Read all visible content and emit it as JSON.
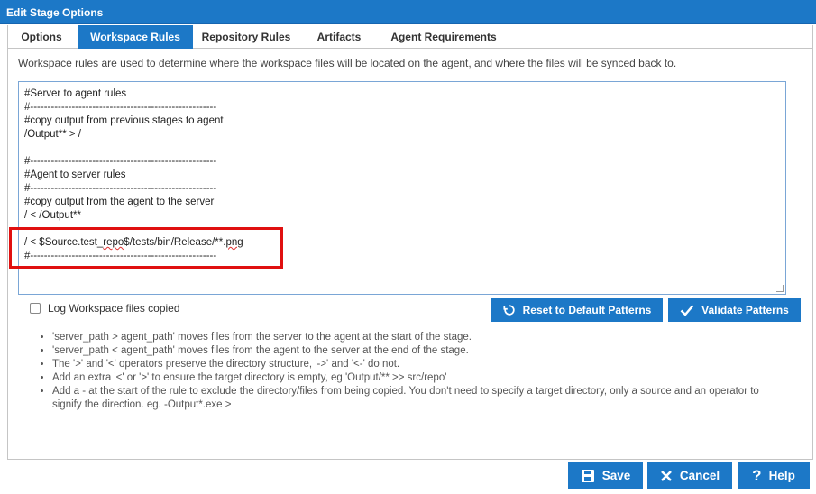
{
  "window": {
    "title": "Edit Stage Options"
  },
  "tabs": [
    {
      "label": "Options"
    },
    {
      "label": "Workspace Rules"
    },
    {
      "label": "Repository Rules"
    },
    {
      "label": "Artifacts"
    },
    {
      "label": "Agent Requirements"
    }
  ],
  "description": "Workspace rules are used to determine where the workspace files will be located on the agent, and where the files will be synced back to.",
  "editor": {
    "lines": [
      "#Server to agent rules",
      "#------------------------------------------------------",
      "#copy output from previous stages to agent",
      "/Output** > /",
      "",
      "#------------------------------------------------------",
      "#Agent to server rules",
      "#------------------------------------------------------",
      "#copy output from the agent to the server",
      "/ < /Output**",
      "",
      "/ < $Source.test_repo$/tests/bin/Release/**.png",
      "#------------------------------------------------------"
    ]
  },
  "log_checkbox": {
    "label": "Log Workspace files copied",
    "checked": false
  },
  "buttons": {
    "reset": "Reset to Default Patterns",
    "validate": "Validate Patterns",
    "save": "Save",
    "cancel": "Cancel",
    "help": "Help"
  },
  "notes": [
    "'server_path > agent_path' moves files from the server to the agent at the start of the stage.",
    "'server_path < agent_path' moves files from the agent to the server at the end of the stage.",
    "The '>' and '<' operators preserve the directory structure, '->' and '<-' do not.",
    "Add an extra '<' or '>' to ensure the target directory is empty, eg 'Output/** >> src/repo'",
    "Add a - at the start of the rule to exclude the directory/files from being copied. You don't need to specify a target directory, only a source and an operator to signify the direction. eg. -Output*.exe >"
  ],
  "colors": {
    "accent": "#1c78c7",
    "highlight": "#e01010"
  }
}
